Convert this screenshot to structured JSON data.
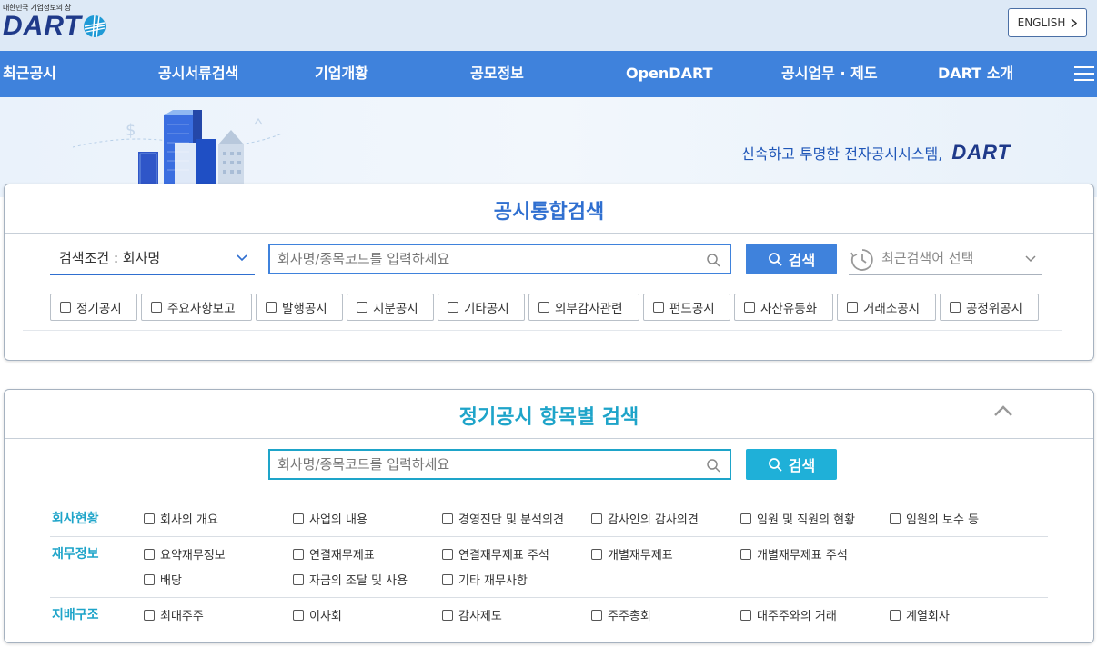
{
  "header": {
    "logo_sub": "대한민국 기업정보의 창",
    "logo_text": "DART",
    "english_label": "ENGLISH"
  },
  "nav": {
    "items": [
      "최근공시",
      "공시서류검색",
      "기업개황",
      "공모정보",
      "OpenDART",
      "공시업무 · 제도",
      "DART 소개"
    ]
  },
  "banner": {
    "tagline": "신속하고 투명한 전자공시시스템,",
    "tagline_brand": "DART"
  },
  "integrated_search": {
    "title": "공시통합검색",
    "condition_label": "검색조건 : 회사명",
    "search_placeholder": "회사명/종목코드를 입력하세요",
    "search_button": "검색",
    "recent_placeholder": "최근검색어 선택",
    "categories": [
      "정기공시",
      "주요사항보고",
      "발행공시",
      "지분공시",
      "기타공시",
      "외부감사관련",
      "펀드공시",
      "자산유동화",
      "거래소공시",
      "공정위공시"
    ]
  },
  "periodic_search": {
    "title": "정기공시 항목별 검색",
    "search_placeholder": "회사명/종목코드를 입력하세요",
    "search_button": "검색",
    "groups": [
      {
        "label": "회사현황",
        "items": [
          "회사의 개요",
          "사업의 내용",
          "경영진단 및 분석의견",
          "감사인의 감사의견",
          "임원 및 직원의 현황",
          "임원의 보수 등"
        ]
      },
      {
        "label": "재무정보",
        "items": [
          "요약재무정보",
          "연결재무제표",
          "연결재무제표 주석",
          "개별재무제표",
          "개별재무제표 주석",
          "배당",
          "자금의 조달 및 사용",
          "기타 재무사항"
        ]
      },
      {
        "label": "지배구조",
        "items": [
          "최대주주",
          "이사회",
          "감사제도",
          "주주총회",
          "대주주와의 거래",
          "계열회사"
        ]
      }
    ]
  },
  "colors": {
    "nav_bg": "#3f82dc",
    "primary_button": "#3f82dc",
    "secondary_button": "#1fb0d8",
    "accent_teal": "#1ea4c9"
  }
}
